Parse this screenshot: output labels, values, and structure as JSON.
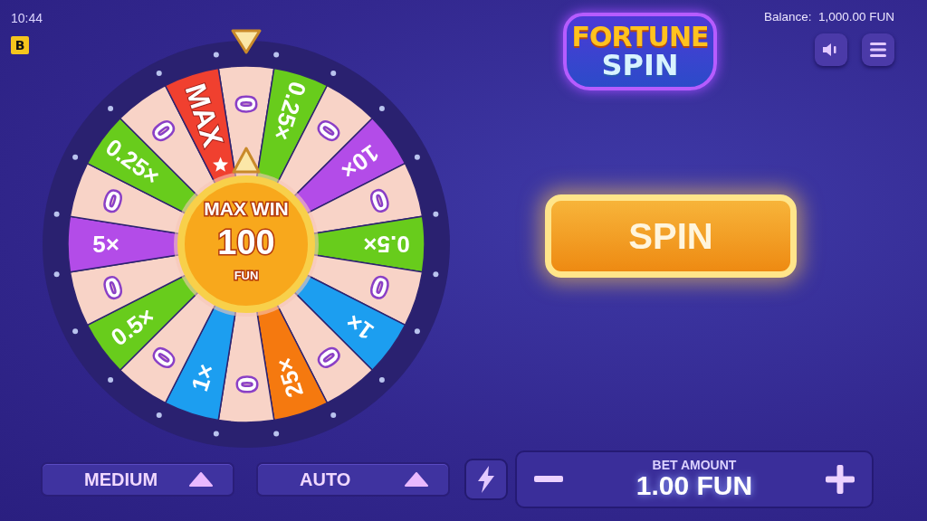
{
  "status": {
    "time": "10:44",
    "badge": "B"
  },
  "header": {
    "logo": [
      "FORTUNE",
      "SPIN"
    ],
    "balance_label": "Balance:",
    "balance": "1,000.00 FUN"
  },
  "wheel": {
    "segments": [
      {
        "label": "0",
        "kind": "zero",
        "color": "#f8d3c7"
      },
      {
        "label": "0.25×",
        "kind": "multiplier",
        "color": "#68cc1c"
      },
      {
        "label": "0",
        "kind": "zero",
        "color": "#f8d3c7"
      },
      {
        "label": "10×",
        "kind": "multiplier",
        "color": "#b34ce8"
      },
      {
        "label": "0",
        "kind": "zero",
        "color": "#f8d3c7"
      },
      {
        "label": "0.5×",
        "kind": "multiplier",
        "color": "#68cc1c"
      },
      {
        "label": "0",
        "kind": "zero",
        "color": "#f8d3c7"
      },
      {
        "label": "1×",
        "kind": "multiplier",
        "color": "#1c9ef0"
      },
      {
        "label": "0",
        "kind": "zero",
        "color": "#f8d3c7"
      },
      {
        "label": "25×",
        "kind": "multiplier",
        "color": "#f5790f"
      },
      {
        "label": "0",
        "kind": "zero",
        "color": "#f8d3c7"
      },
      {
        "label": "1×",
        "kind": "multiplier",
        "color": "#1c9ef0"
      },
      {
        "label": "0",
        "kind": "zero",
        "color": "#f8d3c7"
      },
      {
        "label": "0.5×",
        "kind": "multiplier",
        "color": "#68cc1c"
      },
      {
        "label": "0",
        "kind": "zero",
        "color": "#f8d3c7"
      },
      {
        "label": "5×",
        "kind": "multiplier",
        "color": "#b34ce8"
      },
      {
        "label": "0",
        "kind": "zero",
        "color": "#f8d3c7"
      },
      {
        "label": "0.25×",
        "kind": "multiplier",
        "color": "#68cc1c"
      },
      {
        "label": "0",
        "kind": "zero",
        "color": "#f8d3c7"
      },
      {
        "label": "MAX",
        "kind": "max",
        "color": "#f0402f"
      }
    ],
    "hub": {
      "title": "MAX WIN",
      "amount": "100",
      "currency": "FUN"
    }
  },
  "spin_button": "SPIN",
  "controls": {
    "risk": "MEDIUM",
    "mode": "AUTO",
    "bet_label": "BET AMOUNT",
    "bet": "1.00 FUN"
  }
}
